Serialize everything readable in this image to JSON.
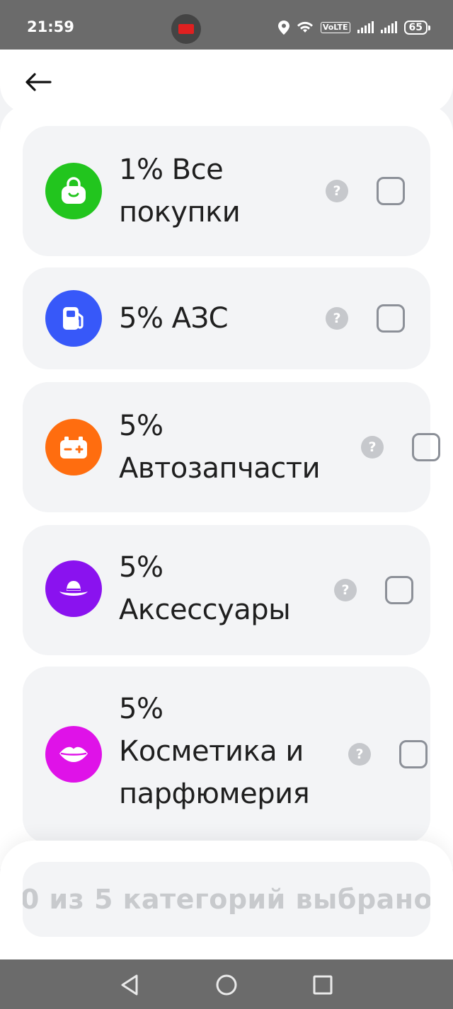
{
  "status_bar": {
    "time": "21:59",
    "volte": "VoLTE",
    "battery": "65"
  },
  "header": {
    "back_icon": "arrow-left-icon"
  },
  "categories": [
    {
      "label_line1": "1% Все",
      "label_line2": "покупки",
      "label_line3": "",
      "icon": "shopping-bag-icon",
      "color": "#22c51e",
      "checked": false
    },
    {
      "label_line1": "5% АЗС",
      "label_line2": "",
      "label_line3": "",
      "icon": "fuel-pump-icon",
      "color": "#3758f9",
      "checked": false
    },
    {
      "label_line1": "5%",
      "label_line2": "Автозапчасти",
      "label_line3": "",
      "icon": "car-battery-icon",
      "color": "#ff6d0f",
      "checked": false
    },
    {
      "label_line1": "5%",
      "label_line2": "Аксессуары",
      "label_line3": "",
      "icon": "hat-icon",
      "color": "#8a12ef",
      "checked": false
    },
    {
      "label_line1": "5%",
      "label_line2": "Косметика и",
      "label_line3": "парфюмерия",
      "icon": "lips-icon",
      "color": "#df12e8",
      "checked": false
    }
  ],
  "help_glyph": "?",
  "footer": {
    "button_label": "0 из 5 категорий выбрано"
  },
  "colors": {
    "status_bar": "#6b6b6b",
    "card_bg": "#f3f4f6",
    "help_icon": "#c6c8cc",
    "checkbox_border": "#8c9098",
    "disabled_text": "#c8cacd"
  }
}
